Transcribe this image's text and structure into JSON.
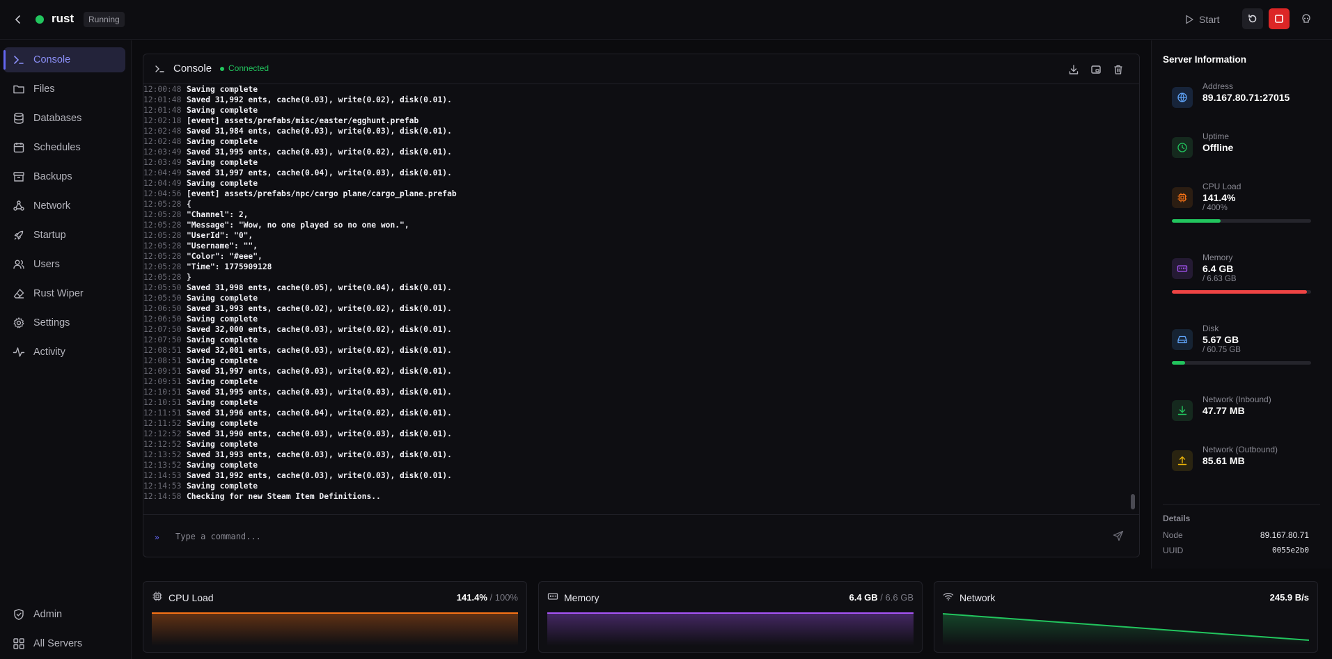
{
  "header": {
    "server_name": "rust",
    "status": "Running",
    "start_label": "Start"
  },
  "sidebar": {
    "items": [
      {
        "label": "Console",
        "icon": "terminal-icon"
      },
      {
        "label": "Files",
        "icon": "folder-icon"
      },
      {
        "label": "Databases",
        "icon": "database-icon"
      },
      {
        "label": "Schedules",
        "icon": "calendar-icon"
      },
      {
        "label": "Backups",
        "icon": "archive-icon"
      },
      {
        "label": "Network",
        "icon": "network-icon"
      },
      {
        "label": "Startup",
        "icon": "rocket-icon"
      },
      {
        "label": "Users",
        "icon": "users-icon"
      },
      {
        "label": "Rust Wiper",
        "icon": "eraser-icon"
      },
      {
        "label": "Settings",
        "icon": "gear-icon"
      },
      {
        "label": "Activity",
        "icon": "activity-icon"
      }
    ],
    "footer": [
      {
        "label": "Admin",
        "icon": "shield-icon"
      },
      {
        "label": "All Servers",
        "icon": "grid-icon"
      }
    ]
  },
  "console": {
    "title": "Console",
    "connection": "Connected",
    "placeholder": "Type a command...",
    "lines": [
      [
        "12:00:48",
        "Saving complete"
      ],
      [
        "12:01:48",
        "Saved 31,992 ents, cache(0.03), write(0.02), disk(0.01)."
      ],
      [
        "12:01:48",
        "Saving complete"
      ],
      [
        "12:02:18",
        "[event] assets/prefabs/misc/easter/egghunt.prefab"
      ],
      [
        "12:02:48",
        "Saved 31,984 ents, cache(0.03), write(0.03), disk(0.01)."
      ],
      [
        "12:02:48",
        "Saving complete"
      ],
      [
        "12:03:49",
        "Saved 31,995 ents, cache(0.03), write(0.02), disk(0.01)."
      ],
      [
        "12:03:49",
        "Saving complete"
      ],
      [
        "12:04:49",
        "Saved 31,997 ents, cache(0.04), write(0.03), disk(0.01)."
      ],
      [
        "12:04:49",
        "Saving complete"
      ],
      [
        "12:04:56",
        "[event] assets/prefabs/npc/cargo plane/cargo_plane.prefab"
      ],
      [
        "12:05:28",
        "{"
      ],
      [
        "12:05:28",
        "\"Channel\": 2,"
      ],
      [
        "12:05:28",
        "\"Message\": \"Wow, no one played so no one won.\","
      ],
      [
        "12:05:28",
        "\"UserId\": \"0\","
      ],
      [
        "12:05:28",
        "\"Username\": \"\","
      ],
      [
        "12:05:28",
        "\"Color\": \"#eee\","
      ],
      [
        "12:05:28",
        "\"Time\": 1775909128"
      ],
      [
        "12:05:28",
        "}"
      ],
      [
        "12:05:50",
        "Saved 31,998 ents, cache(0.05), write(0.04), disk(0.01)."
      ],
      [
        "12:05:50",
        "Saving complete"
      ],
      [
        "12:06:50",
        "Saved 31,993 ents, cache(0.02), write(0.02), disk(0.01)."
      ],
      [
        "12:06:50",
        "Saving complete"
      ],
      [
        "12:07:50",
        "Saved 32,000 ents, cache(0.03), write(0.02), disk(0.01)."
      ],
      [
        "12:07:50",
        "Saving complete"
      ],
      [
        "12:08:51",
        "Saved 32,001 ents, cache(0.03), write(0.02), disk(0.01)."
      ],
      [
        "12:08:51",
        "Saving complete"
      ],
      [
        "12:09:51",
        "Saved 31,997 ents, cache(0.03), write(0.02), disk(0.01)."
      ],
      [
        "12:09:51",
        "Saving complete"
      ],
      [
        "12:10:51",
        "Saved 31,995 ents, cache(0.03), write(0.03), disk(0.01)."
      ],
      [
        "12:10:51",
        "Saving complete"
      ],
      [
        "12:11:51",
        "Saved 31,996 ents, cache(0.04), write(0.02), disk(0.01)."
      ],
      [
        "12:11:52",
        "Saving complete"
      ],
      [
        "12:12:52",
        "Saved 31,990 ents, cache(0.03), write(0.03), disk(0.01)."
      ],
      [
        "12:12:52",
        "Saving complete"
      ],
      [
        "12:13:52",
        "Saved 31,993 ents, cache(0.03), write(0.03), disk(0.01)."
      ],
      [
        "12:13:52",
        "Saving complete"
      ],
      [
        "12:14:53",
        "Saved 31,992 ents, cache(0.03), write(0.03), disk(0.01)."
      ],
      [
        "12:14:53",
        "Saving complete"
      ],
      [
        "12:14:58",
        "Checking for new Steam Item Definitions.."
      ]
    ]
  },
  "server_info": {
    "title": "Server Information",
    "address": {
      "label": "Address",
      "value": "89.167.80.71:27015",
      "color": "#60a5fa"
    },
    "uptime": {
      "label": "Uptime",
      "value": "Offline",
      "color": "#22c55e"
    },
    "cpu": {
      "label": "CPU Load",
      "value": "141.4%",
      "sub": "/ 400%",
      "fraction": 0.35,
      "color": "#f97316",
      "bar_color": "#22c55e"
    },
    "memory": {
      "label": "Memory",
      "value": "6.4 GB",
      "sub": "/ 6.63 GB",
      "fraction": 0.97,
      "color": "#a855f7",
      "bar_color": "#ef4444"
    },
    "disk": {
      "label": "Disk",
      "value": "5.67 GB",
      "sub": "/ 60.75 GB",
      "fraction": 0.093,
      "color": "#60a5fa",
      "bar_color": "#22c55e"
    },
    "net_in": {
      "label": "Network (Inbound)",
      "value": "47.77 MB",
      "color": "#22c55e"
    },
    "net_out": {
      "label": "Network (Outbound)",
      "value": "85.61 MB",
      "color": "#eab308"
    },
    "details_title": "Details",
    "node_label": "Node",
    "node_value": "89.167.80.71",
    "uuid_label": "UUID",
    "uuid_value": "0055e2b0"
  },
  "stats": {
    "cpu": {
      "label": "CPU Load",
      "value": "141.4%",
      "sub": "/ 100%",
      "color": "#f97316"
    },
    "memory": {
      "label": "Memory",
      "value": "6.4 GB",
      "sub": "/ 6.6 GB",
      "color": "#a855f7"
    },
    "network": {
      "label": "Network",
      "value": "245.9 B/s",
      "color": "#22c55e"
    }
  }
}
